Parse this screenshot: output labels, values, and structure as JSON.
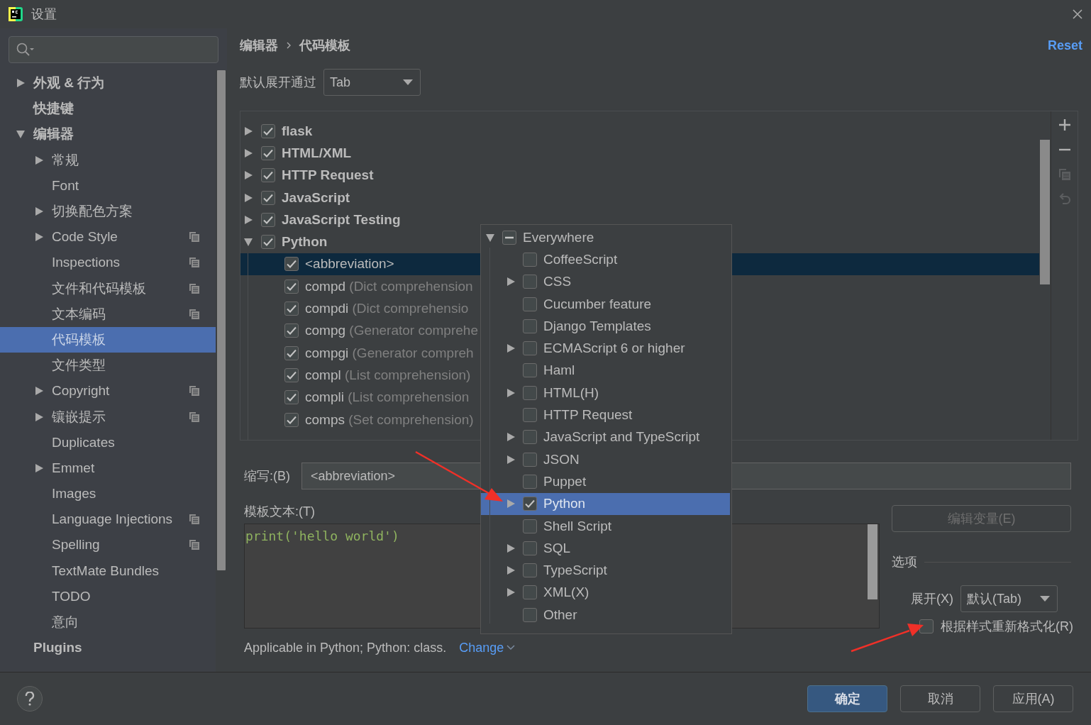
{
  "window": {
    "title": "设置"
  },
  "sidebar": {
    "items": [
      {
        "label": "外观 & 行为",
        "kind": "node",
        "expanded": false,
        "project_icon": false,
        "selected": false
      },
      {
        "label": "快捷键",
        "kind": "leaf",
        "project_icon": false,
        "selected": false
      },
      {
        "label": "编辑器",
        "kind": "node",
        "expanded": true,
        "project_icon": false,
        "selected": false,
        "children": [
          {
            "label": "常规",
            "kind": "node",
            "expanded": false,
            "project_icon": false,
            "selected": false
          },
          {
            "label": "Font",
            "kind": "leaf",
            "project_icon": false,
            "selected": false
          },
          {
            "label": "切换配色方案",
            "kind": "node",
            "expanded": false,
            "project_icon": false,
            "selected": false
          },
          {
            "label": "Code Style",
            "kind": "node",
            "expanded": false,
            "project_icon": true,
            "selected": false
          },
          {
            "label": "Inspections",
            "kind": "leaf",
            "project_icon": true,
            "selected": false
          },
          {
            "label": "文件和代码模板",
            "kind": "leaf",
            "project_icon": true,
            "selected": false
          },
          {
            "label": "文本编码",
            "kind": "leaf",
            "project_icon": true,
            "selected": false
          },
          {
            "label": "代码模板",
            "kind": "leaf",
            "project_icon": false,
            "selected": true
          },
          {
            "label": "文件类型",
            "kind": "leaf",
            "project_icon": false,
            "selected": false
          },
          {
            "label": "Copyright",
            "kind": "node",
            "expanded": false,
            "project_icon": true,
            "selected": false
          },
          {
            "label": "镶嵌提示",
            "kind": "node",
            "expanded": false,
            "project_icon": true,
            "selected": false
          },
          {
            "label": "Duplicates",
            "kind": "leaf",
            "project_icon": false,
            "selected": false
          },
          {
            "label": "Emmet",
            "kind": "node",
            "expanded": false,
            "project_icon": false,
            "selected": false
          },
          {
            "label": "Images",
            "kind": "leaf",
            "project_icon": false,
            "selected": false
          },
          {
            "label": "Language Injections",
            "kind": "leaf",
            "project_icon": true,
            "selected": false
          },
          {
            "label": "Spelling",
            "kind": "leaf",
            "project_icon": true,
            "selected": false
          },
          {
            "label": "TextMate Bundles",
            "kind": "leaf",
            "project_icon": false,
            "selected": false
          },
          {
            "label": "TODO",
            "kind": "leaf",
            "project_icon": false,
            "selected": false
          },
          {
            "label": "意向",
            "kind": "leaf",
            "project_icon": false,
            "selected": false
          }
        ]
      },
      {
        "label": "Plugins",
        "kind": "leaf",
        "project_icon": false,
        "selected": false
      }
    ]
  },
  "breadcrumb": [
    "编辑器",
    "代码模板"
  ],
  "reset": "Reset",
  "expand_with": {
    "label": "默认展开通过",
    "value": "Tab"
  },
  "templates": {
    "groups": [
      {
        "label": "flask",
        "checked": true,
        "expanded": false
      },
      {
        "label": "HTML/XML",
        "checked": true,
        "expanded": false
      },
      {
        "label": "HTTP Request",
        "checked": true,
        "expanded": false
      },
      {
        "label": "JavaScript",
        "checked": true,
        "expanded": false
      },
      {
        "label": "JavaScript Testing",
        "checked": true,
        "expanded": false
      },
      {
        "label": "Python",
        "checked": true,
        "expanded": true,
        "children": [
          {
            "name": "<abbreviation>",
            "checked": true,
            "selected": true
          },
          {
            "name": "compd",
            "description": "(Dict comprehension",
            "checked": true,
            "selected": false
          },
          {
            "name": "compdi",
            "description": "(Dict comprehensio",
            "checked": true,
            "selected": false
          },
          {
            "name": "compg",
            "description": "(Generator comprehe",
            "checked": true,
            "selected": false
          },
          {
            "name": "compgi",
            "description": "(Generator compreh",
            "checked": true,
            "selected": false
          },
          {
            "name": "compl",
            "description": "(List comprehension)",
            "checked": true,
            "selected": false
          },
          {
            "name": "compli",
            "description": "(List comprehension",
            "checked": true,
            "selected": false
          },
          {
            "name": "comps",
            "description": "(Set comprehension)",
            "checked": true,
            "selected": false
          }
        ]
      }
    ],
    "toolbar": [
      {
        "kind": "add",
        "disabled": false
      },
      {
        "kind": "remove",
        "disabled": false
      },
      {
        "kind": "copy",
        "disabled": true
      },
      {
        "kind": "revert",
        "disabled": true
      }
    ]
  },
  "abbreviation": {
    "label": "缩写:(B)",
    "value": "<abbreviation>"
  },
  "template_text": {
    "label": "模板文本:(T)",
    "value": "print('hello world')"
  },
  "applicable": {
    "text": "Applicable in Python; Python: class.",
    "link": "Change"
  },
  "edit_variables": {
    "label": "编辑变量(E)",
    "disabled": true
  },
  "options": {
    "title": "选项",
    "expand": {
      "label": "展开(X)",
      "value": "默认(Tab)"
    },
    "reformat": {
      "label": "根据样式重新格式化(R)",
      "checked": false
    }
  },
  "context_popup": {
    "items": [
      {
        "label": "Everywhere",
        "partial": true,
        "kind": "node",
        "expanded": true,
        "selected": false,
        "children": [
          {
            "label": "CoffeeScript",
            "checked": false,
            "kind": "leaf",
            "selected": false
          },
          {
            "label": "CSS",
            "checked": false,
            "kind": "node",
            "expanded": false,
            "selected": false
          },
          {
            "label": "Cucumber feature",
            "checked": false,
            "kind": "leaf",
            "selected": false
          },
          {
            "label": "Django Templates",
            "checked": false,
            "kind": "leaf",
            "selected": false
          },
          {
            "label": "ECMAScript 6 or higher",
            "checked": false,
            "kind": "node",
            "expanded": false,
            "selected": false
          },
          {
            "label": "Haml",
            "checked": false,
            "kind": "leaf",
            "selected": false
          },
          {
            "label": "HTML(H)",
            "checked": false,
            "kind": "node",
            "expanded": false,
            "selected": false
          },
          {
            "label": "HTTP Request",
            "checked": false,
            "kind": "leaf",
            "selected": false
          },
          {
            "label": "JavaScript and TypeScript",
            "checked": false,
            "kind": "node",
            "expanded": false,
            "selected": false
          },
          {
            "label": "JSON",
            "checked": false,
            "kind": "node",
            "expanded": false,
            "selected": false
          },
          {
            "label": "Puppet",
            "checked": false,
            "kind": "leaf",
            "selected": false
          },
          {
            "label": "Python",
            "checked": true,
            "kind": "node",
            "expanded": false,
            "selected": true
          },
          {
            "label": "Shell Script",
            "checked": false,
            "kind": "leaf",
            "selected": false
          },
          {
            "label": "SQL",
            "checked": false,
            "kind": "node",
            "expanded": false,
            "selected": false
          },
          {
            "label": "TypeScript",
            "checked": false,
            "kind": "node",
            "expanded": false,
            "selected": false
          },
          {
            "label": "XML(X)",
            "checked": false,
            "kind": "node",
            "expanded": false,
            "selected": false
          },
          {
            "label": "Other",
            "checked": false,
            "kind": "leaf",
            "selected": false
          }
        ]
      }
    ]
  },
  "footer": {
    "buttons": [
      {
        "label": "确定",
        "kind": "primary"
      },
      {
        "label": "取消",
        "kind": "default"
      },
      {
        "label": "应用(A)",
        "kind": "default"
      }
    ]
  }
}
